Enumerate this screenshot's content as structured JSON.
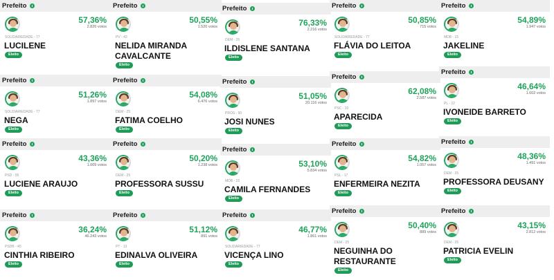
{
  "label_role": "Prefeito",
  "label_elected": "Eleito",
  "cards": [
    {
      "party": "SOLIDARIEDADE - 77",
      "pct": "57,36%",
      "votes": "2.826 votos",
      "name": "LUCILENE"
    },
    {
      "party": "PV - 43",
      "pct": "50,55%",
      "votes": "1.520 votos",
      "name": "NELIDA MIRANDA CAVALCANTE"
    },
    {
      "party": "DEM - 25",
      "pct": "76,33%",
      "votes": "2.216 votos",
      "name": "ILDISLENE SANTANA"
    },
    {
      "party": "SOLIDARIEDADE - 77",
      "pct": "50,85%",
      "votes": "715 votos",
      "name": "FLÁVIA DO LEITOA"
    },
    {
      "party": "MDB - 15",
      "pct": "54,89%",
      "votes": "1.947 votos",
      "name": "JAKELINE"
    },
    {
      "party": "SOLIDARIEDADE - 77",
      "pct": "51,26%",
      "votes": "1.897 votos",
      "name": "NEGA"
    },
    {
      "party": "DEM - 25",
      "pct": "54,08%",
      "votes": "6.476 votos",
      "name": "FATIMA COELHO"
    },
    {
      "party": "PROS - 90",
      "pct": "51,05%",
      "votes": "20.116 votos",
      "name": "JOSI NUNES"
    },
    {
      "party": "PSC - 20",
      "pct": "62,08%",
      "votes": "2.587 votos",
      "name": "APARECIDA"
    },
    {
      "party": "PL - 22",
      "pct": "46,64%",
      "votes": "1.602 votos",
      "name": "IVONEIDE BARRETO"
    },
    {
      "party": "PSD - 55",
      "pct": "43,36%",
      "votes": "1.009 votos",
      "name": "LUCIENE ARAUJO"
    },
    {
      "party": "DEM - 25",
      "pct": "50,20%",
      "votes": "1.238 votos",
      "name": "PROFESSORA SUSSU"
    },
    {
      "party": "MDB - 15",
      "pct": "53,10%",
      "votes": "5.834 votos",
      "name": "CAMILA FERNANDES"
    },
    {
      "party": "PSL - 17",
      "pct": "54,82%",
      "votes": "1.057 votos",
      "name": "ENFERMEIRA NEZITA"
    },
    {
      "party": "DEM - 25",
      "pct": "48,36%",
      "votes": "1.491 votos",
      "name": "PROFESSORA DEUSANY"
    },
    {
      "party": "PSDB - 45",
      "pct": "36,24%",
      "votes": "46.243 votos",
      "name": "CINTHIA RIBEIRO"
    },
    {
      "party": "PT - 13",
      "pct": "51,12%",
      "votes": "891 votos",
      "name": "EDINALVA OLIVEIRA"
    },
    {
      "party": "SOLIDARIEDADE - 77",
      "pct": "46,77%",
      "votes": "1.861 votos",
      "name": "VICENÇA LINO"
    },
    {
      "party": "DEM - 25",
      "pct": "50,40%",
      "votes": "889 votos",
      "name": "NEGUINHA DO RESTAURANTE"
    },
    {
      "party": "DEM - 25",
      "pct": "43,15%",
      "votes": "2.812 votos",
      "name": "PATRICIA EVELIN"
    }
  ]
}
